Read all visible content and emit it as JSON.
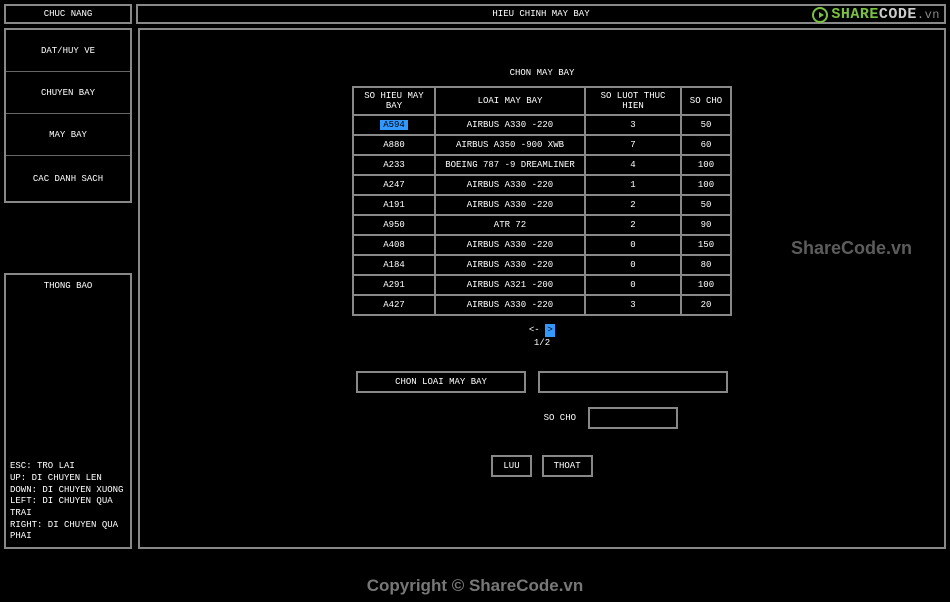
{
  "header": {
    "left_label": "CHUC NANG",
    "right_label": "HIEU CHINH MAY BAY"
  },
  "menu": {
    "items": [
      "DAT/HUY VE",
      "CHUYEN BAY",
      "MAY BAY",
      "CAC DANH SACH"
    ]
  },
  "thongbao": {
    "title": "THONG BAO",
    "help": [
      "ESC: TRO LAI",
      "UP: DI CHUYEN LEN",
      "DOWN: DI CHUYEN XUONG",
      "LEFT: DI CHUYEN QUA TRAI",
      "RIGHT: DI CHUYEN QUA PHAI"
    ]
  },
  "content": {
    "title": "CHON MAY BAY",
    "columns": [
      "SO HIEU MAY BAY",
      "LOAI MAY BAY",
      "SO LUOT THUC HIEN",
      "SO CHO"
    ],
    "rows": [
      {
        "id": "A594",
        "type": "AIRBUS A330 -220",
        "count": "3",
        "seat": "50",
        "selected": true
      },
      {
        "id": "A880",
        "type": "AIRBUS A350 -900 XWB",
        "count": "7",
        "seat": "60"
      },
      {
        "id": "A233",
        "type": "BOEING 787 -9 DREAMLINER",
        "count": "4",
        "seat": "100"
      },
      {
        "id": "A247",
        "type": "AIRBUS A330 -220",
        "count": "1",
        "seat": "100"
      },
      {
        "id": "A191",
        "type": "AIRBUS A330 -220",
        "count": "2",
        "seat": "50"
      },
      {
        "id": "A950",
        "type": "ATR 72",
        "count": "2",
        "seat": "90"
      },
      {
        "id": "A408",
        "type": "AIRBUS A330 -220",
        "count": "0",
        "seat": "150"
      },
      {
        "id": "A184",
        "type": "AIRBUS A330 -220",
        "count": "0",
        "seat": "80"
      },
      {
        "id": "A291",
        "type": "AIRBUS A321 -200",
        "count": "0",
        "seat": "100"
      },
      {
        "id": "A427",
        "type": "AIRBUS A330 -220",
        "count": "3",
        "seat": "20"
      }
    ],
    "pager": {
      "arrow_left": "<-",
      "arrow_right": ">",
      "page": "1/2"
    }
  },
  "form": {
    "btn_chon_loai": "CHON LOAI MAY BAY",
    "label_socho": "SO CHO",
    "btn_save": "LUU",
    "btn_exit": "THOAT",
    "loai_value": "",
    "socho_value": ""
  },
  "branding": {
    "logo_share": "SHARE",
    "logo_code": "CODE",
    "logo_vn": ".vn",
    "watermark": "ShareCode.vn",
    "footer": "Copyright © ShareCode.vn"
  }
}
